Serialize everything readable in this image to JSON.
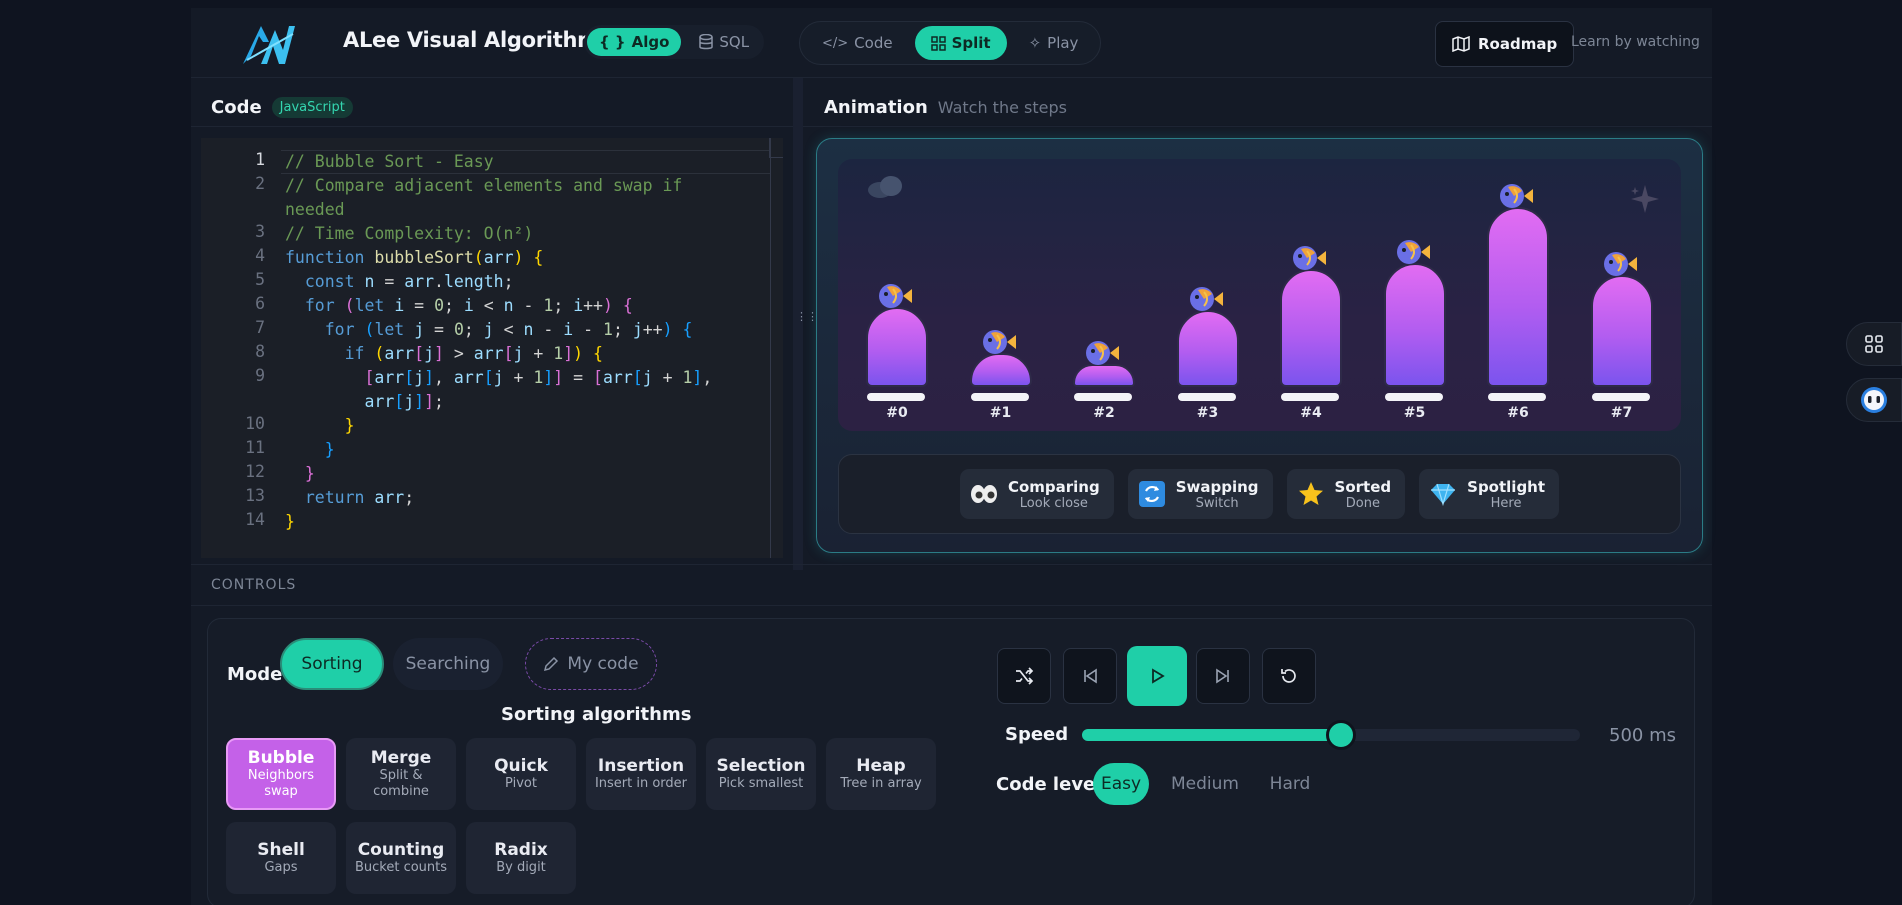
{
  "header": {
    "title": "ALee Visual Algorithm",
    "algo_tab": "Algo",
    "sql_tab": "SQL",
    "view_tabs": [
      "Code",
      "Split",
      "Play"
    ],
    "roadmap": "Roadmap",
    "tagline": "Learn by watching"
  },
  "code_panel": {
    "title": "Code",
    "language": "JavaScript",
    "line_numbers": [
      "1",
      "2",
      "3",
      "4",
      "5",
      "6",
      "7",
      "8",
      "9",
      "10",
      "11",
      "12",
      "13",
      "14"
    ]
  },
  "animation": {
    "title": "Animation",
    "subtitle": "Watch the steps",
    "bars": [
      {
        "label": "#0",
        "value": 80
      },
      {
        "label": "#1",
        "value": 34
      },
      {
        "label": "#2",
        "value": 23
      },
      {
        "label": "#3",
        "value": 77
      },
      {
        "label": "#4",
        "value": 118
      },
      {
        "label": "#5",
        "value": 124
      },
      {
        "label": "#6",
        "value": 180
      },
      {
        "label": "#7",
        "value": 112
      }
    ],
    "legend": [
      {
        "title": "Comparing",
        "sub": "Look close",
        "icon": "eyes-icon"
      },
      {
        "title": "Swapping",
        "sub": "Switch",
        "icon": "swap-icon"
      },
      {
        "title": "Sorted",
        "sub": "Done",
        "icon": "star-icon"
      },
      {
        "title": "Spotlight",
        "sub": "Here",
        "icon": "diamond-icon"
      }
    ]
  },
  "controls": {
    "section_label": "CONTROLS",
    "mode_label": "Mode",
    "modes": [
      "Sorting",
      "Searching",
      "My code"
    ],
    "algorithms_title": "Sorting algorithms",
    "algorithms": [
      {
        "name": "Bubble",
        "desc": "Neighbors swap"
      },
      {
        "name": "Merge",
        "desc": "Split & combine"
      },
      {
        "name": "Quick",
        "desc": "Pivot"
      },
      {
        "name": "Insertion",
        "desc": "Insert in order"
      },
      {
        "name": "Selection",
        "desc": "Pick smallest"
      },
      {
        "name": "Heap",
        "desc": "Tree in array"
      },
      {
        "name": "Shell",
        "desc": "Gaps"
      },
      {
        "name": "Counting",
        "desc": "Bucket counts"
      },
      {
        "name": "Radix",
        "desc": "By digit"
      }
    ],
    "speed_label": "Speed",
    "speed_value": "500 ms",
    "speed_fraction": 0.52,
    "code_level_label": "Code level",
    "levels": [
      "Easy",
      "Medium",
      "Hard"
    ]
  },
  "colors": {
    "accent": "#1fcfa8",
    "active_algo": "#c461e8"
  }
}
